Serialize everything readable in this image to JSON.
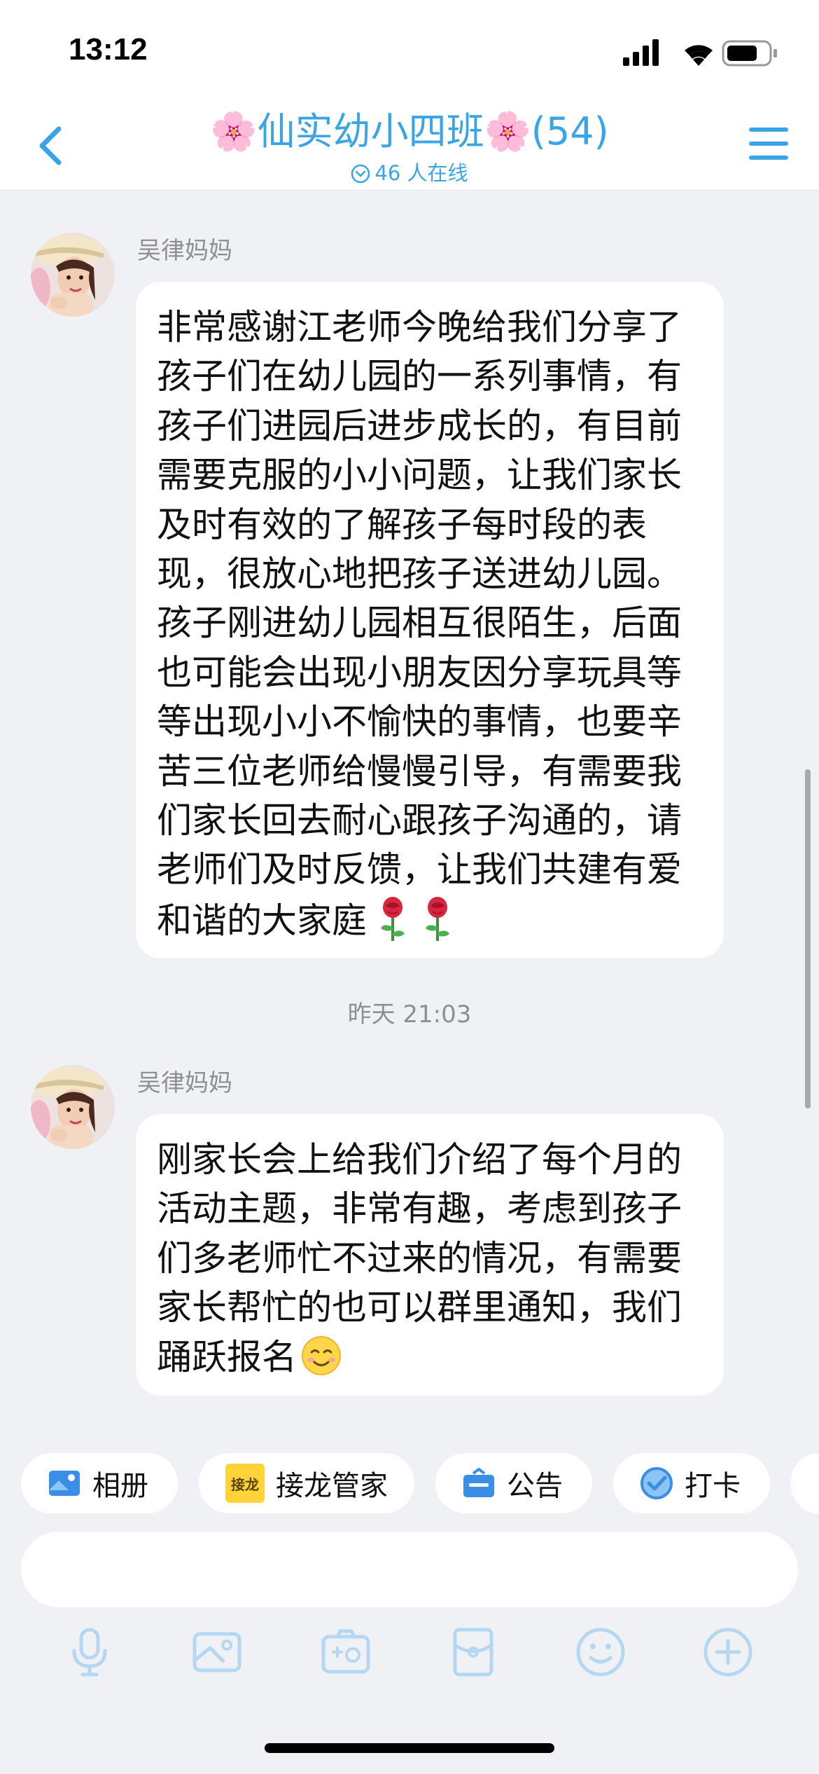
{
  "status_bar": {
    "time": "13:12"
  },
  "header": {
    "title": "🌸仙实幼小四班🌸(54)",
    "online": "46 人在线"
  },
  "messages": [
    {
      "sender": "吴律妈妈",
      "text": "非常感谢江老师今晚给我们分享了孩子们在幼儿园的一系列事情，有孩子们进园后进步成长的，有目前需要克服的小小问题，让我们家长及时有效的了解孩子每时段的表现，很放心地把孩子送进幼儿园。孩子刚进幼儿园相互很陌生，后面也可能会出现小朋友因分享玩具等等出现小小不愉快的事情，也要辛苦三位老师给慢慢引导，有需要我们家长回去耐心跟孩子沟通的，请老师们及时反馈，让我们共建有爱和谐的大家庭",
      "emoji": [
        "rose",
        "rose"
      ]
    },
    {
      "sender": "吴律妈妈",
      "text": "刚家长会上给我们介绍了每个月的活动主题，非常有趣，考虑到孩子们多老师忙不过来的情况，有需要家长帮忙的也可以群里通知，我们踊跃报名",
      "emoji": [
        "smiling-face"
      ]
    }
  ],
  "timestamp": "昨天 21:03",
  "quick_actions": [
    {
      "label": "相册",
      "icon": "album-icon"
    },
    {
      "label": "接龙管家",
      "icon": "jielong-icon",
      "badge": "接龙"
    },
    {
      "label": "公告",
      "icon": "announcement-icon"
    },
    {
      "label": "打卡",
      "icon": "checkin-icon"
    }
  ],
  "input": {
    "value": "",
    "placeholder": ""
  },
  "toolbar": [
    "microphone-icon",
    "image-icon",
    "camera-icon",
    "red-packet-icon",
    "emoji-icon",
    "plus-icon"
  ],
  "colors": {
    "accent": "#3aa5e6",
    "toolbar_icon": "#b4d8f2",
    "background": "#f0f1f5"
  }
}
